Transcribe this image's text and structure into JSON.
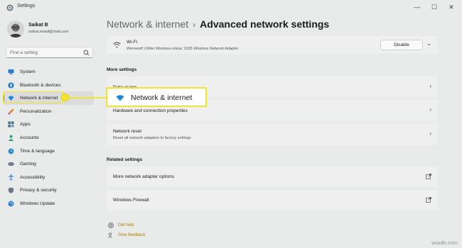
{
  "app": {
    "title": "Settings"
  },
  "window_controls": {
    "minimize": "—",
    "maximize": "☐",
    "close": "✕"
  },
  "user": {
    "name": "Saikat B",
    "email": "saikat.email@mail.com"
  },
  "search": {
    "placeholder": "Find a setting"
  },
  "sidebar": {
    "items": [
      {
        "label": "System",
        "icon": "monitor-icon"
      },
      {
        "label": "Bluetooth & devices",
        "icon": "bluetooth-icon"
      },
      {
        "label": "Network & internet",
        "icon": "wifi-icon",
        "selected": true
      },
      {
        "label": "Personalization",
        "icon": "brush-icon"
      },
      {
        "label": "Apps",
        "icon": "apps-icon"
      },
      {
        "label": "Accounts",
        "icon": "person-icon"
      },
      {
        "label": "Time & language",
        "icon": "globe-clock-icon"
      },
      {
        "label": "Gaming",
        "icon": "gamepad-icon"
      },
      {
        "label": "Accessibility",
        "icon": "accessibility-icon"
      },
      {
        "label": "Privacy & security",
        "icon": "shield-icon"
      },
      {
        "label": "Windows Update",
        "icon": "update-icon"
      }
    ]
  },
  "breadcrumb": {
    "parent": "Network & internet",
    "separator": "›",
    "current": "Advanced network settings"
  },
  "adapter": {
    "name": "Wi-Fi",
    "description": "Werewolf | Killer Wireless-n/a/ac 1535 Wireless Network Adapter",
    "button": "Disable",
    "expand": "⌄"
  },
  "more_settings": {
    "title": "More settings",
    "items": [
      {
        "title": "Data usage",
        "chevron": "›"
      },
      {
        "title": "Hardware and connection properties",
        "chevron": "›"
      },
      {
        "title": "Network reset",
        "subtitle": "Reset all network adapters to factory settings",
        "chevron": "›"
      }
    ]
  },
  "related_settings": {
    "title": "Related settings",
    "items": [
      {
        "title": "More network adapter options"
      },
      {
        "title": "Windows Firewall"
      }
    ]
  },
  "help": {
    "get_help": "Get help",
    "give_feedback": "Give feedback"
  },
  "callout": {
    "label": "Network & internet"
  },
  "watermark": "wsxdn.com",
  "colors": {
    "accent": "#d07a00",
    "highlight": "#f3e430",
    "wifi_blue": "#1a86d9"
  }
}
